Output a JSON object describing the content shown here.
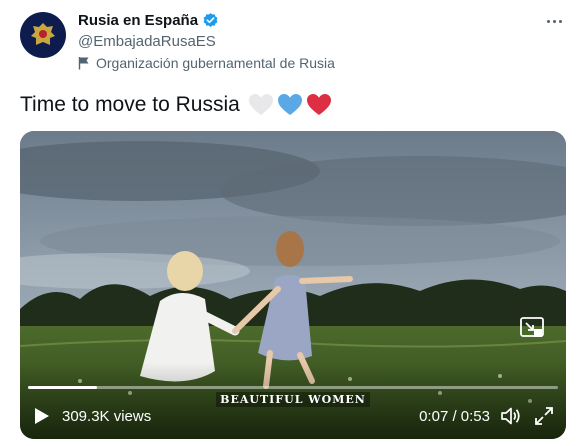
{
  "account": {
    "display_name": "Rusia en España",
    "handle": "@EmbajadaRusaES",
    "affiliation": "Organización gubernamental de Rusia"
  },
  "tweet": {
    "text": "Time to move to Russia",
    "emoji": [
      "white-heart",
      "blue-heart",
      "red-heart"
    ]
  },
  "video": {
    "views": "309.3K views",
    "watermark": "BEAUTIFUL WOMEN",
    "time": "0:07 / 0:53",
    "progress": 0.13
  },
  "colors": {
    "handle_gray": "#536471",
    "verified_blue": "#1d9bf0",
    "avatar_navy": "#0e1b4d",
    "heart_white": "#e8e8ea",
    "heart_blue": "#5aa9e6",
    "heart_red": "#dd2e44"
  },
  "icons": [
    "avatar-emblem-icon",
    "verified-icon",
    "flag-icon",
    "more-icon",
    "pip-icon",
    "play-icon",
    "volume-icon",
    "fullscreen-icon"
  ]
}
